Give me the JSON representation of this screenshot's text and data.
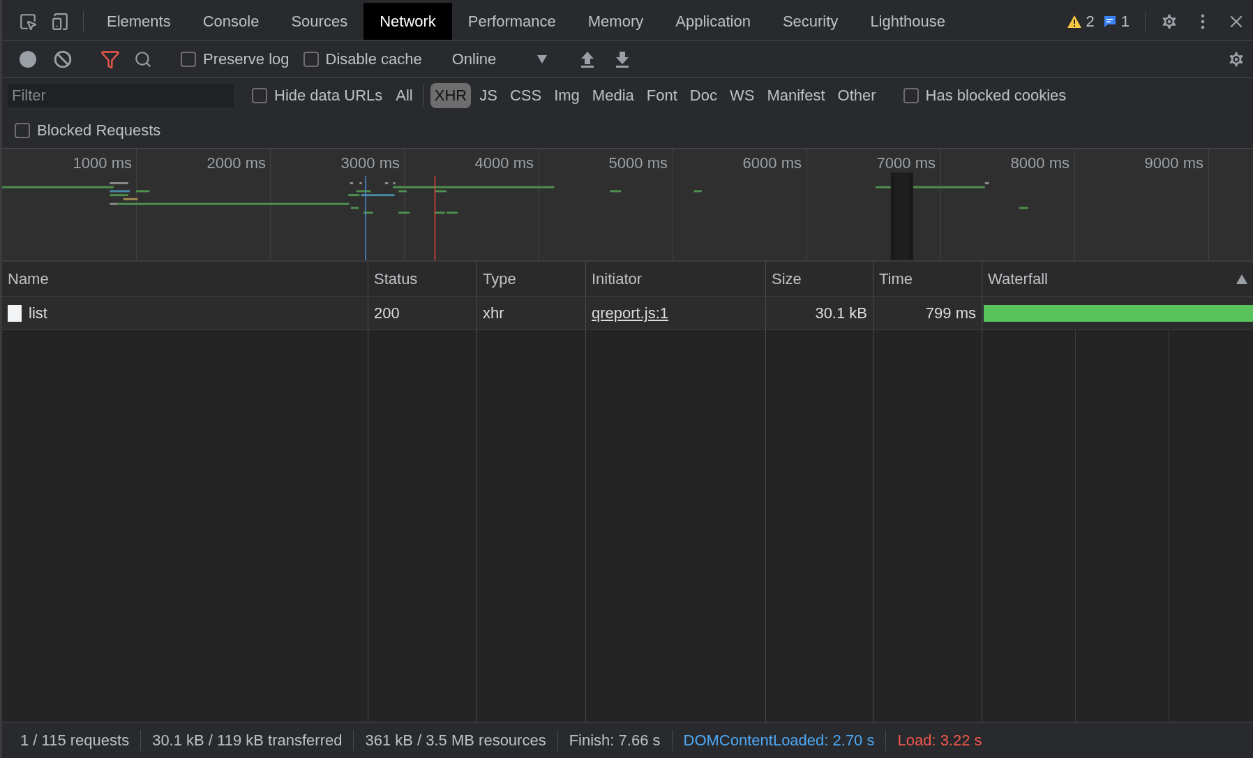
{
  "tabs": [
    {
      "label": "Elements",
      "selected": false
    },
    {
      "label": "Console",
      "selected": false
    },
    {
      "label": "Sources",
      "selected": false
    },
    {
      "label": "Network",
      "selected": true
    },
    {
      "label": "Performance",
      "selected": false
    },
    {
      "label": "Memory",
      "selected": false
    },
    {
      "label": "Application",
      "selected": false
    },
    {
      "label": "Security",
      "selected": false
    },
    {
      "label": "Lighthouse",
      "selected": false
    }
  ],
  "issues": {
    "warnings": "2",
    "messages": "1"
  },
  "toolbar": {
    "recording": false,
    "filter_active": true,
    "preserve_log": {
      "label": "Preserve log",
      "checked": false
    },
    "disable_cache": {
      "label": "Disable cache",
      "checked": false
    },
    "throttling": "Online"
  },
  "filter_bar": {
    "placeholder": "Filter",
    "hide_data_urls": {
      "label": "Hide data URLs",
      "checked": false
    },
    "types": [
      {
        "label": "All",
        "selected": false
      },
      {
        "label": "XHR",
        "selected": true
      },
      {
        "label": "JS",
        "selected": false
      },
      {
        "label": "CSS",
        "selected": false
      },
      {
        "label": "Img",
        "selected": false
      },
      {
        "label": "Media",
        "selected": false
      },
      {
        "label": "Font",
        "selected": false
      },
      {
        "label": "Doc",
        "selected": false
      },
      {
        "label": "WS",
        "selected": false
      },
      {
        "label": "Manifest",
        "selected": false
      },
      {
        "label": "Other",
        "selected": false
      }
    ],
    "has_blocked_cookies": {
      "label": "Has blocked cookies",
      "checked": false
    },
    "blocked_requests": {
      "label": "Blocked Requests",
      "checked": false
    }
  },
  "overview": {
    "tick_labels": [
      "1000 ms",
      "2000 ms",
      "3000 ms",
      "4000 ms",
      "5000 ms",
      "6000 ms",
      "7000 ms",
      "8000 ms",
      "9000 ms"
    ]
  },
  "table": {
    "columns": [
      "Name",
      "Status",
      "Type",
      "Initiator",
      "Size",
      "Time",
      "Waterfall"
    ],
    "rows": [
      {
        "name": "list",
        "status": "200",
        "type": "xhr",
        "initiator": "qreport.js:1",
        "size": "30.1 kB",
        "time": "799 ms"
      }
    ]
  },
  "status_bar": [
    {
      "text": "1 / 115 requests",
      "color": "#bdc1c6"
    },
    {
      "text": "30.1 kB / 119 kB transferred",
      "color": "#bdc1c6"
    },
    {
      "text": "361 kB / 3.5 MB resources",
      "color": "#bdc1c6"
    },
    {
      "text": "Finish: 7.66 s",
      "color": "#bdc1c6"
    },
    {
      "text": "DOMContentLoaded: 2.70 s",
      "color": "#4ea9f5"
    },
    {
      "text": "Load: 3.22 s",
      "color": "#f1584f"
    }
  ]
}
